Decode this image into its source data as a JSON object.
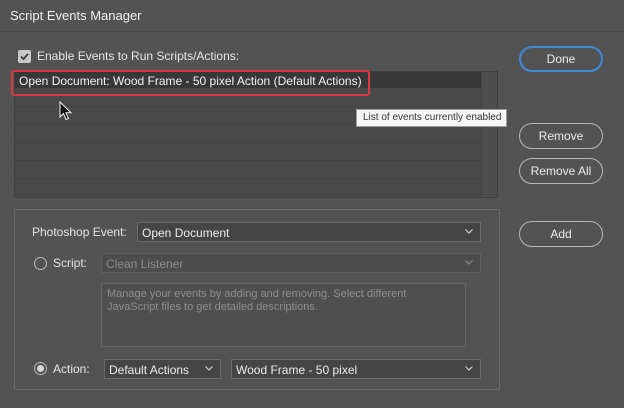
{
  "window": {
    "title": "Script Events Manager"
  },
  "enable": {
    "label": "Enable Events to Run Scripts/Actions:",
    "checked": true
  },
  "events_list": {
    "items": [
      "Open Document: Wood Frame - 50 pixel Action (Default Actions)"
    ],
    "tooltip": "List of events currently enabled"
  },
  "buttons": {
    "done": "Done",
    "remove": "Remove",
    "remove_all": "Remove All",
    "add": "Add"
  },
  "form": {
    "photoshop_event_label": "Photoshop Event:",
    "photoshop_event_value": "Open Document",
    "script_label": "Script:",
    "script_value": "Clean Listener",
    "description": "Manage your events by adding and removing. Select different JavaScript files to get detailed descriptions.",
    "action_label": "Action:",
    "action_set_value": "Default Actions",
    "action_value": "Wood Frame - 50 pixel",
    "selected_source": "action"
  },
  "colors": {
    "accent": "#3d8bd9",
    "highlight": "#d9393d",
    "background": "#535353"
  },
  "icons": [
    "checkbox-check-icon",
    "chevron-down-icon",
    "radio-icon",
    "mouse-cursor-icon"
  ]
}
